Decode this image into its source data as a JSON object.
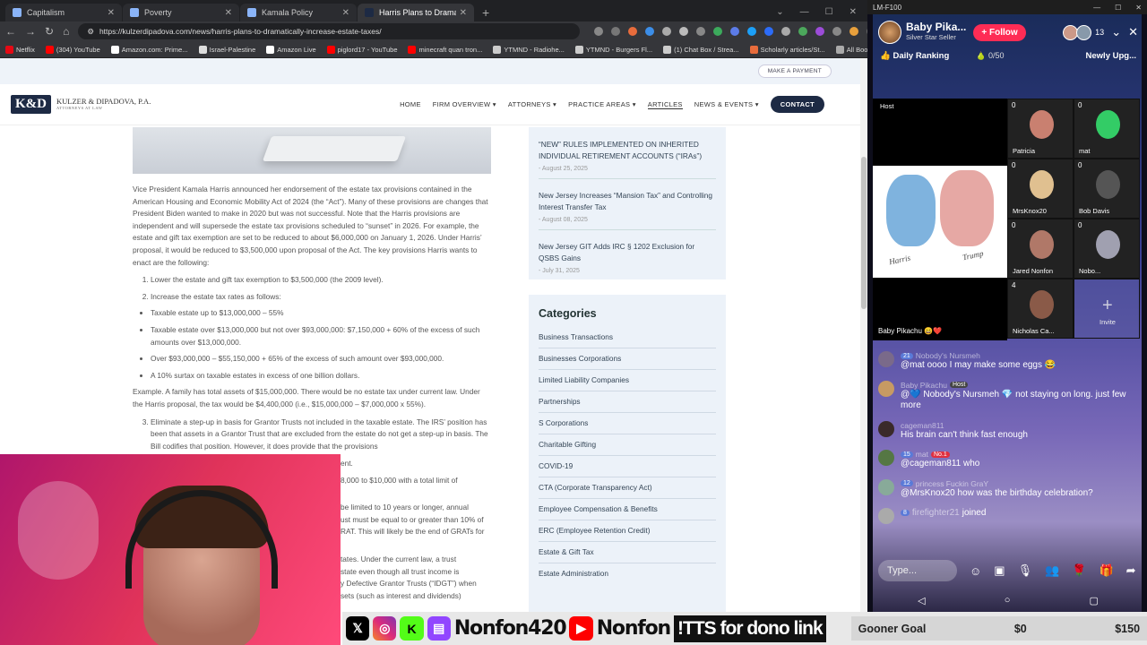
{
  "browser": {
    "tabs": [
      {
        "label": "Capitalism",
        "active": false
      },
      {
        "label": "Poverty",
        "active": false
      },
      {
        "label": "Kamala Policy",
        "active": false
      },
      {
        "label": "Harris Plans to Dramatically Inc",
        "active": true
      }
    ],
    "url": "https://kulzerdipadova.com/news/harris-plans-to-dramatically-increase-estate-taxes/",
    "bookmarks": [
      "Netflix",
      "(304) YouTube",
      "Amazon.com: Prime...",
      "Israel-Palestine",
      "Amazon Live",
      "piglord17 - YouTube",
      "minecraft quan tron...",
      "YTMND - Radiohe...",
      "YTMND - Burgers Fl...",
      "(1) Chat Box / Strea...",
      "Scholarly articles/St..."
    ],
    "all_bookmarks": "All Bookmarks"
  },
  "site": {
    "make_payment": "MAKE A PAYMENT",
    "logo_mark": "K&D",
    "logo_name": "KULZER & DIPADOVA, P.A.",
    "logo_sub": "ATTORNEYS AT LAW",
    "nav": [
      "HOME",
      "FIRM OVERVIEW ▾",
      "ATTORNEYS ▾",
      "PRACTICE AREAS ▾",
      "ARTICLES",
      "NEWS & EVENTS ▾"
    ],
    "contact": "CONTACT",
    "article": {
      "intro": "Vice President Kamala Harris announced her endorsement of the estate tax provisions contained in the American Housing and Economic Mobility Act of 2024 (the “Act”).  Many of these provisions are changes that President Biden wanted to make in 2020 but was not successful.  Note that the Harris provisions are independent and will supersede the estate tax provisions scheduled to “sunset” in 2026.  For example, the estate and gift tax exemption are set to be reduced to about $6,000,000 on January 1, 2026.  Under Harris’ proposal, it would be reduced to $3,500,000 upon proposal of the Act.  The key provisions Harris wants to enact are the following:",
      "ol1": [
        "Lower the estate and gift tax exemption to $3,500,000 (the 2009 level).",
        "Increase the estate tax rates as follows:"
      ],
      "bullets": [
        "Taxable estate up to $13,000,000 – 55%",
        "Taxable estate over $13,000,000 but not over $93,000,000: $7,150,000 + 60% of the excess of such amounts over $13,000,000.",
        "Over $93,000,000 – $55,150,000 + 65% of the excess of such amount over $93,000,000.",
        "A 10% surtax on taxable estates in excess of one billion dollars."
      ],
      "example": "Example.  A family has total assets of $15,000,000.  There would be no estate tax under current law.  Under the Harris proposal, the tax would be $4,400,000 (i.e., $15,000,000 – $7,000,000 x 55%).",
      "item3": "Eliminate a step-up in basis for Grantor Trusts not included in the taxable estate. The IRS’ position has been that assets in a Grantor Trust that are excluded from the estate do not get a step-up in basis. The Bill codifies that position. However, it does provide that the provisions",
      "frag1": "ent.",
      "frag2": "8,000 to $10,000 with a total limit of",
      "frag3": "be limited to 10 years or longer, annual",
      "frag4": "ust must be equal to or greater than 10% of",
      "frag5": "RAT. This will likely be the end of GRATs for",
      "frag6": "tates. Under the current law, a trust",
      "frag7": "state even though all trust income is",
      "frag8": "y Defective Grantor Trusts (“IDGT”) when",
      "frag9": "sets (such as interest and dividends)"
    },
    "recent_posts": [
      {
        "title": "“NEW” RULES IMPLEMENTED ON INHERITED INDIVIDUAL RETIREMENT ACCOUNTS (“IRAs”)",
        "date": "- August 25, 2025"
      },
      {
        "title": "New Jersey Increases “Mansion Tax” and Controlling Interest Transfer Tax",
        "date": "- August 08, 2025"
      },
      {
        "title": "New Jersey GIT Adds IRC § 1202 Exclusion for QSBS Gains",
        "date": "- July 31, 2025"
      }
    ],
    "categories_title": "Categories",
    "categories": [
      "Business Transactions",
      "Businesses Corporations",
      "Limited Liability Companies",
      "Partnerships",
      "S Corporations",
      "Charitable Gifting",
      "COVID-19",
      "CTA (Corporate Transparency Act)",
      "Employee Compensation & Benefits",
      "ERC (Employee Retention Credit)",
      "Estate & Gift Tax",
      "Estate Administration"
    ]
  },
  "stream_bar": {
    "handle1": "Nonfon420",
    "handle2": "Nonfon",
    "tts": "!TTS for dono link",
    "goal_name": "Gooner Goal",
    "goal_current": "$0",
    "goal_target": "$150",
    "goal_progress": 0
  },
  "live": {
    "window_title": "LM-F100",
    "host_name": "Baby Pika...",
    "host_tier": "Silver Star Seller",
    "follow": "Follow",
    "viewer_count": "13",
    "daily_ranking": "Daily Ranking",
    "gift_progress": "0/50",
    "newly": "Newly Upg...",
    "host_tile_label": "Host",
    "host_tile_name": "Baby Pikachu 😄❤️",
    "art_left": "Harris",
    "art_right": "Trump",
    "guests": [
      {
        "name": "Patricia",
        "count": "0"
      },
      {
        "name": "mat",
        "count": "0"
      },
      {
        "name": "MrsKnox20",
        "count": "0"
      },
      {
        "name": "Bob Davis",
        "count": "0"
      },
      {
        "name": "Jared Nonfon",
        "count": "0"
      },
      {
        "name": "Nobo...",
        "count": "0"
      },
      {
        "name": "Nicholas Ca...",
        "count": "4"
      }
    ],
    "invite": "Invite",
    "chat": [
      {
        "user": "Nobody's Nursmeh",
        "level": "21",
        "role": "",
        "text": "@mat oooo I may make some eggs 😂",
        "color": "#7a6a8a"
      },
      {
        "user": "Baby Pikachu",
        "level": "",
        "role": "Host",
        "text": "@💙 Nobody's Nursmeh 💎 not staying on long.  just few more",
        "color": "#c79a63"
      },
      {
        "user": "cageman811",
        "level": "",
        "role": "",
        "text": "His brain can't think fast enough",
        "color": "#3a2a2a"
      },
      {
        "user": "mat",
        "level": "15",
        "role": "No.1",
        "text": "@cageman811 who",
        "color": "#557744"
      },
      {
        "user": "princess Fuckin GraY",
        "level": "12",
        "role": "",
        "text": "@MrsKnox20 how was the birthday celebration?",
        "color": "#88aa99"
      },
      {
        "user": "firefighter21",
        "level": "8",
        "role": "",
        "text": "joined",
        "color": "#aaaaaa"
      }
    ],
    "type_placeholder": "Type..."
  }
}
